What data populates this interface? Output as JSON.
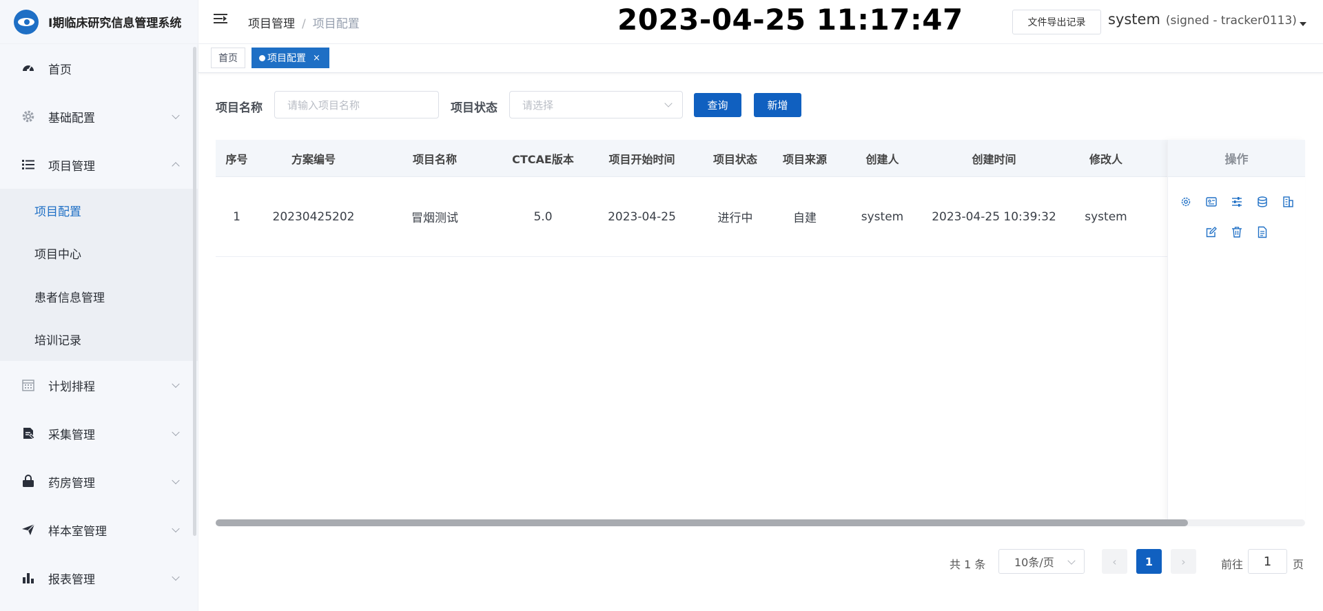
{
  "app": {
    "title": "I期临床研究信息管理系统"
  },
  "sidebar": {
    "items": [
      {
        "label": "首页",
        "icon": "dashboard-icon"
      },
      {
        "label": "基础配置",
        "icon": "gear-icon"
      },
      {
        "label": "项目管理",
        "icon": "list-icon"
      },
      {
        "label": "计划排程",
        "icon": "calendar-icon"
      },
      {
        "label": "采集管理",
        "icon": "clipboard-icon"
      },
      {
        "label": "药房管理",
        "icon": "lock-bag-icon"
      },
      {
        "label": "样本室管理",
        "icon": "send-icon"
      },
      {
        "label": "报表管理",
        "icon": "bar-chart-icon"
      }
    ],
    "submenu": [
      "项目配置",
      "项目中心",
      "患者信息管理",
      "培训记录"
    ]
  },
  "header": {
    "breadcrumb": [
      "项目管理",
      "项目配置"
    ],
    "clock": "2023-04-25 11:17:47",
    "export_label": "文件导出记录",
    "user_name": "system",
    "user_sign": "(signed - tracker0113)"
  },
  "tags": {
    "home": "首页",
    "active": "项目配置",
    "close": "×"
  },
  "search": {
    "name_label": "项目名称",
    "name_placeholder": "请输入项目名称",
    "status_label": "项目状态",
    "status_placeholder": "请选择",
    "query_label": "查询",
    "add_label": "新增"
  },
  "table": {
    "columns": [
      "序号",
      "方案编号",
      "项目名称",
      "CTCAE版本",
      "项目开始时间",
      "项目状态",
      "项目来源",
      "创建人",
      "创建时间",
      "修改人"
    ],
    "op_header": "操作",
    "rows": [
      [
        "1",
        "20230425202",
        "冒烟测试",
        "5.0",
        "2023-04-25",
        "进行中",
        "自建",
        "system",
        "2023-04-25 10:39:32",
        "system"
      ]
    ]
  },
  "pagination": {
    "total": "共 1 条",
    "page_size": "10条/页",
    "prev": "‹",
    "current": "1",
    "next": "›",
    "goto_label": "前往",
    "goto_value": "1",
    "page_label": "页"
  },
  "colors": {
    "accent": "#1e6fc5",
    "button": "#1060c0",
    "sidebar_bg": "#f5f7fb"
  }
}
